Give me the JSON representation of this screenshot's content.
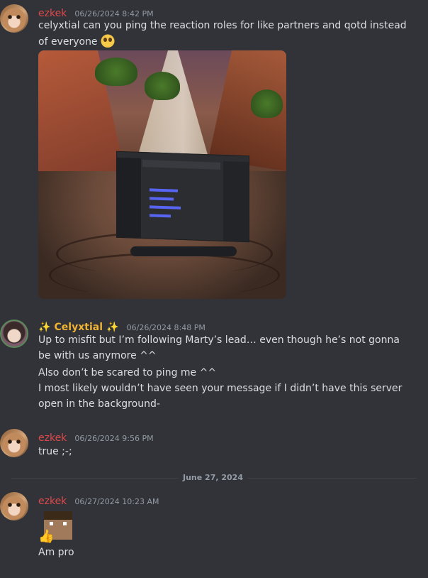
{
  "messages": [
    {
      "author": "ezkek",
      "timestamp": "06/26/2024 8:42 PM",
      "line1": "celyxtial can you ping the reaction roles for like partners and qotd instead",
      "line2": "of everyone",
      "emoji": "pleading-face"
    },
    {
      "author": "Celyxtial",
      "author_prefix": "✨",
      "author_suffix": "✨",
      "timestamp": "06/26/2024 8:48 PM",
      "line1": "Up to misfit but I’m following Marty’s lead… even though he’s not gonna",
      "line2": "be with us anymore ^^",
      "line3": "Also don’t be scared to ping me ^^",
      "line4": "I most likely wouldn’t have seen your message if I didn’t have this server",
      "line5": "open in the background-"
    },
    {
      "author": "ezkek",
      "timestamp": "06/26/2024 9:56 PM",
      "line1": "true ;-;"
    },
    {
      "author": "ezkek",
      "timestamp": "06/27/2024 10:23 AM",
      "emoji": "thumbs-up-steve",
      "line1": "Am pro"
    }
  ],
  "divider": {
    "label": "June 27, 2024"
  },
  "colors": {
    "background": "#313338",
    "ezkek": "#e0484a",
    "celyxtial": "#f0b232",
    "timestamp": "#949ba4",
    "text": "#dbdee1"
  }
}
